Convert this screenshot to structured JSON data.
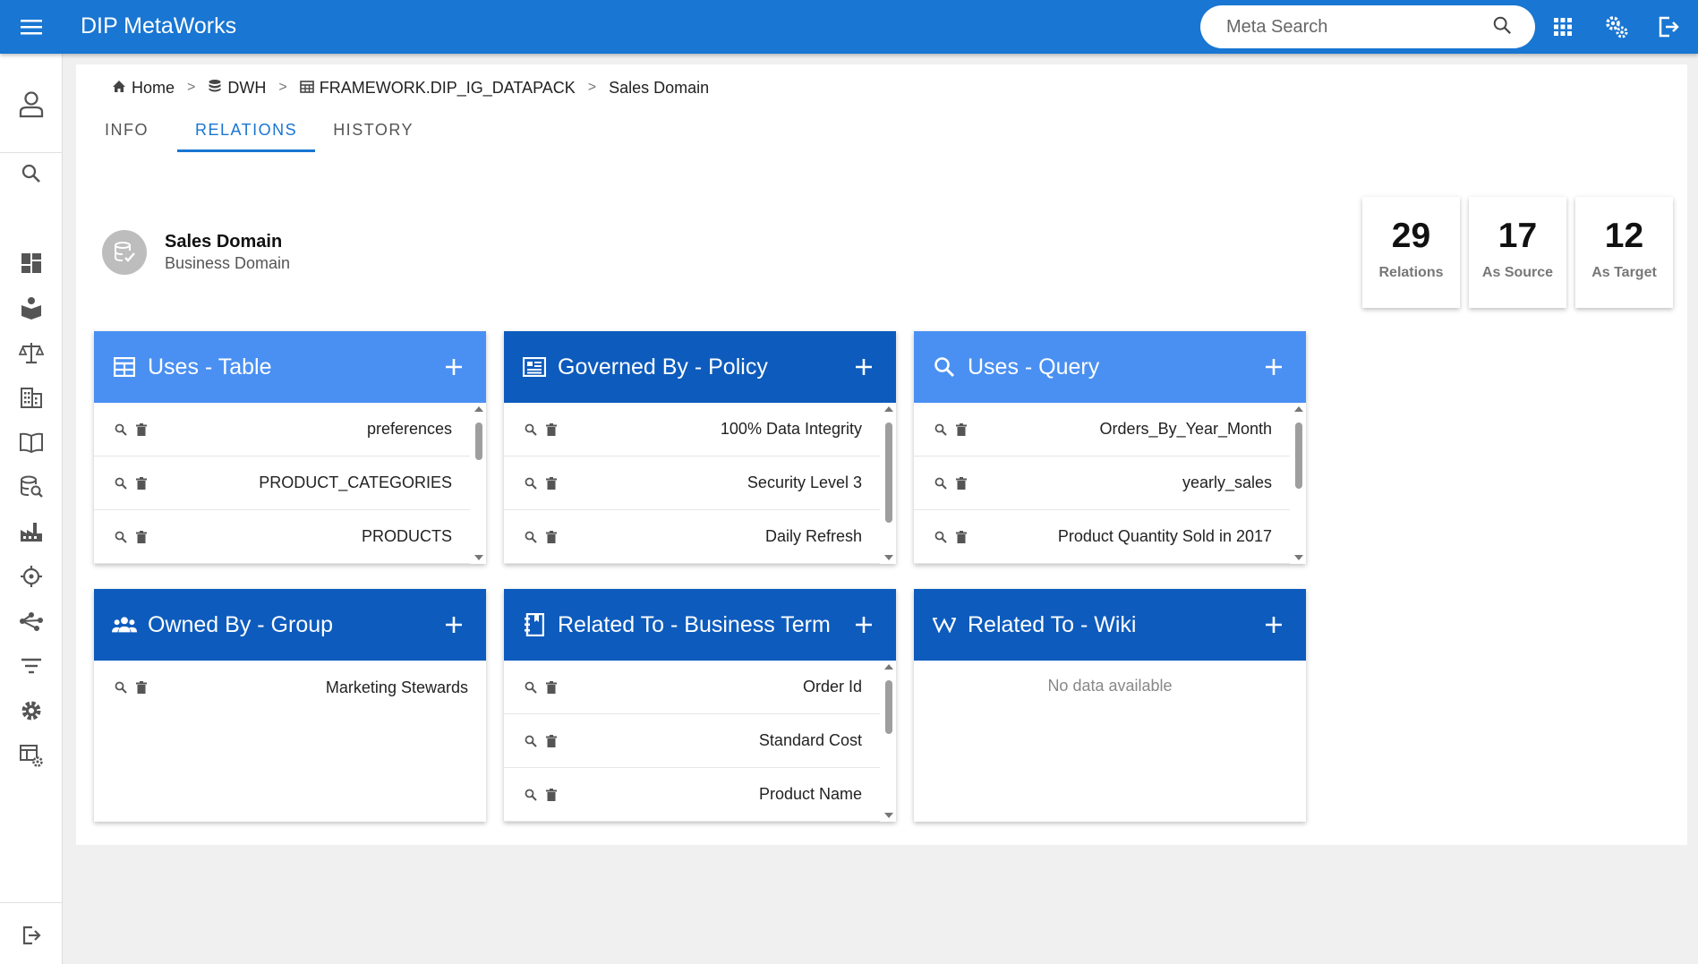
{
  "app": {
    "title": "DIP MetaWorks"
  },
  "search": {
    "placeholder": "Meta Search"
  },
  "topbar_icons": [
    "apps-grid-icon",
    "settings-gears-icon",
    "logout-icon"
  ],
  "sidebar": {
    "icons": [
      "user-icon",
      "search-icon",
      "dashboard-icon",
      "book-hand-icon",
      "scale-icon",
      "building-icon",
      "open-book-icon",
      "database-search-icon",
      "factory-icon",
      "crosshair-icon",
      "share-icon",
      "filter-icon",
      "gear-icon",
      "table-settings-icon",
      "logout-icon"
    ]
  },
  "breadcrumb": {
    "items": [
      {
        "label": "Home",
        "icon": "home-icon"
      },
      {
        "label": "DWH",
        "icon": "database-icon"
      },
      {
        "label": "FRAMEWORK.DIP_IG_DATAPACK",
        "icon": "table-icon"
      },
      {
        "label": "Sales Domain",
        "icon": ""
      }
    ],
    "separator": ">"
  },
  "tabs": [
    {
      "label": "INFO",
      "active": false
    },
    {
      "label": "RELATIONS",
      "active": true
    },
    {
      "label": "HISTORY",
      "active": false
    }
  ],
  "view_icons": [
    "list-view-icon",
    "graph-view-icon"
  ],
  "entity": {
    "title": "Sales Domain",
    "subtitle": "Business Domain",
    "icon": "business-domain-icon"
  },
  "stats": [
    {
      "value": "29",
      "label": "Relations"
    },
    {
      "value": "17",
      "label": "As Source"
    },
    {
      "value": "12",
      "label": "As Target"
    }
  ],
  "cards": [
    {
      "title": "Uses - Table",
      "icon": "table-icon",
      "style": "light",
      "rows": [
        "preferences",
        "PRODUCT_CATEGORIES",
        "PRODUCTS"
      ],
      "scroll": true
    },
    {
      "title": "Governed By - Policy",
      "icon": "policy-icon",
      "style": "dark",
      "rows": [
        "100% Data Integrity",
        "Security Level 3",
        "Daily Refresh"
      ],
      "scroll": true
    },
    {
      "title": "Uses - Query",
      "icon": "search-icon",
      "style": "light",
      "rows": [
        "Orders_By_Year_Month",
        "yearly_sales",
        "Product Quantity Sold in 2017"
      ],
      "scroll": true
    },
    {
      "title": "Owned By - Group",
      "icon": "group-icon",
      "style": "dark",
      "rows": [
        "Marketing Stewards"
      ],
      "scroll": false
    },
    {
      "title": "Related To - Business Term",
      "icon": "notebook-icon",
      "style": "dark",
      "rows": [
        "Order Id",
        "Standard Cost",
        "Product Name"
      ],
      "scroll": true
    },
    {
      "title": "Related To - Wiki",
      "icon": "wiki-icon",
      "style": "dark",
      "rows": [],
      "scroll": false,
      "empty": "No data available"
    }
  ],
  "colors": {
    "topbar": "#1976d2",
    "card_light": "#4a90f2",
    "card_dark": "#0d5bbd",
    "tab_active": "#1976d2"
  }
}
